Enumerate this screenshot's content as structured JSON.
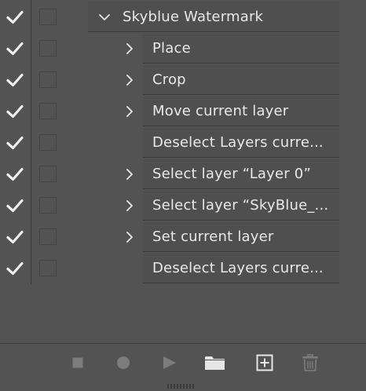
{
  "actions_panel": {
    "rows": [
      {
        "label": "Skyblue Watermark",
        "expanded": true,
        "has_children": true,
        "enabled": true
      },
      {
        "label": "Place",
        "expanded": false,
        "has_children": true,
        "enabled": true
      },
      {
        "label": "Crop",
        "expanded": false,
        "has_children": true,
        "enabled": true
      },
      {
        "label": "Move current layer",
        "expanded": false,
        "has_children": true,
        "enabled": true
      },
      {
        "label": "Deselect Layers curre...",
        "expanded": false,
        "has_children": false,
        "enabled": true
      },
      {
        "label": "Select layer “Layer 0”",
        "expanded": false,
        "has_children": true,
        "enabled": true
      },
      {
        "label": "Select layer “SkyBlue_...",
        "expanded": false,
        "has_children": true,
        "enabled": true
      },
      {
        "label": "Set current layer",
        "expanded": false,
        "has_children": true,
        "enabled": true
      },
      {
        "label": "Deselect Layers curre...",
        "expanded": false,
        "has_children": false,
        "enabled": true
      }
    ]
  },
  "toolbar": {
    "buttons": [
      {
        "name": "stop-playing-button",
        "icon": "stop-icon",
        "enabled": false
      },
      {
        "name": "begin-recording-button",
        "icon": "record-icon",
        "enabled": false
      },
      {
        "name": "play-selection-button",
        "icon": "play-icon",
        "enabled": false
      },
      {
        "name": "create-new-set-button",
        "icon": "folder-icon",
        "enabled": true
      },
      {
        "name": "create-new-action-button",
        "icon": "plus-square-icon",
        "enabled": true
      },
      {
        "name": "delete-button",
        "icon": "trash-icon",
        "enabled": false
      }
    ]
  },
  "colors": {
    "panel_bg": "#535353",
    "row_bg": "#4f4f4f",
    "text": "#e9e9e9",
    "check": "#f2f2f2",
    "icon_enabled": "#e6e6e6",
    "icon_disabled": "#7d7d7d"
  }
}
